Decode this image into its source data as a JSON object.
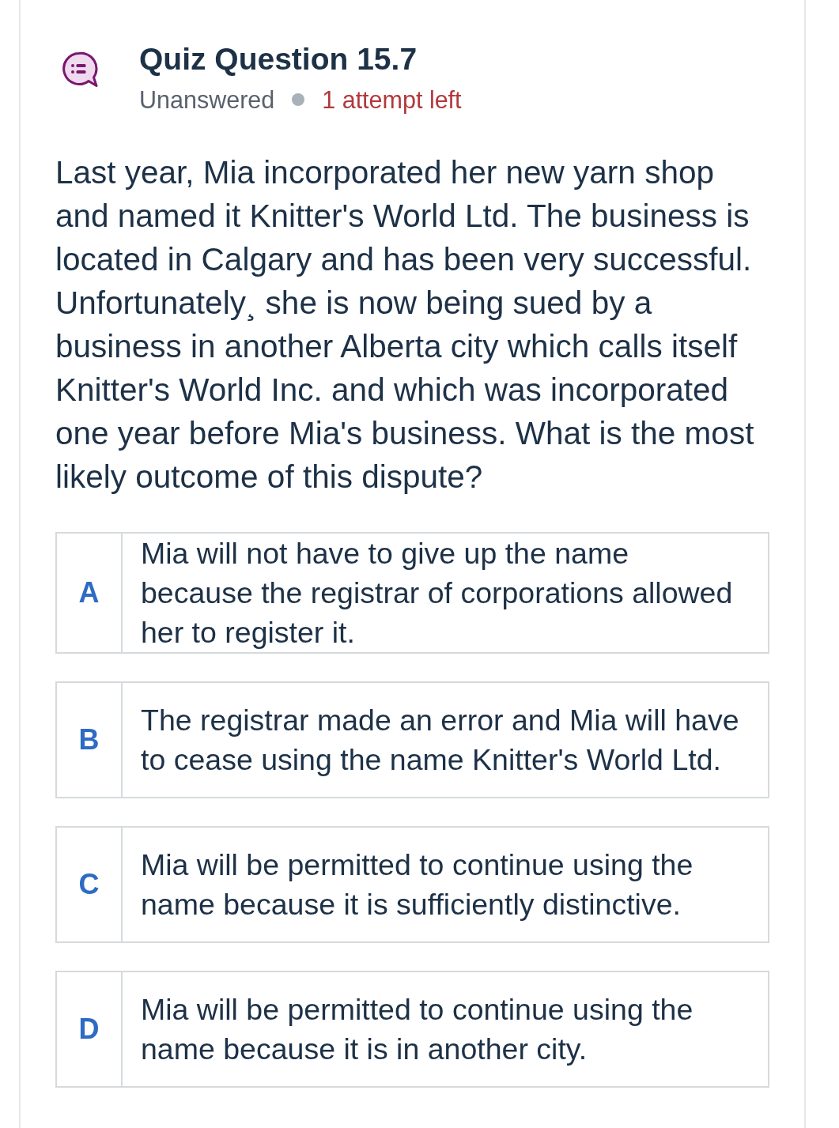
{
  "header": {
    "title": "Quiz Question 15.7",
    "status": "Unanswered",
    "attempts": "1 attempt left"
  },
  "question": "Last year, Mia incorporated her new yarn shop and named it Knitter's World Ltd. The business is located in Calgary and has been very successful. Unfortunately¸ she is now being sued by a business in another Alberta city which calls itself Knitter's World Inc. and which was incorporated one year before Mia's business. What is the most likely outcome of this dispute?",
  "choices": [
    {
      "letter": "A",
      "text": "Mia will not have to give up the name because the registrar of corporations allowed her to register it.",
      "selected": false
    },
    {
      "letter": "B",
      "text": "The registrar made an error and Mia will have to cease using the name Knitter's World Ltd.",
      "selected": false
    },
    {
      "letter": "C",
      "text": "Mia will be permitted to continue using the name because it is sufficiently distinctive.",
      "selected": false
    },
    {
      "letter": "D",
      "text": "Mia will be permitted to continue using the name because it is in another city.",
      "selected": false
    }
  ]
}
